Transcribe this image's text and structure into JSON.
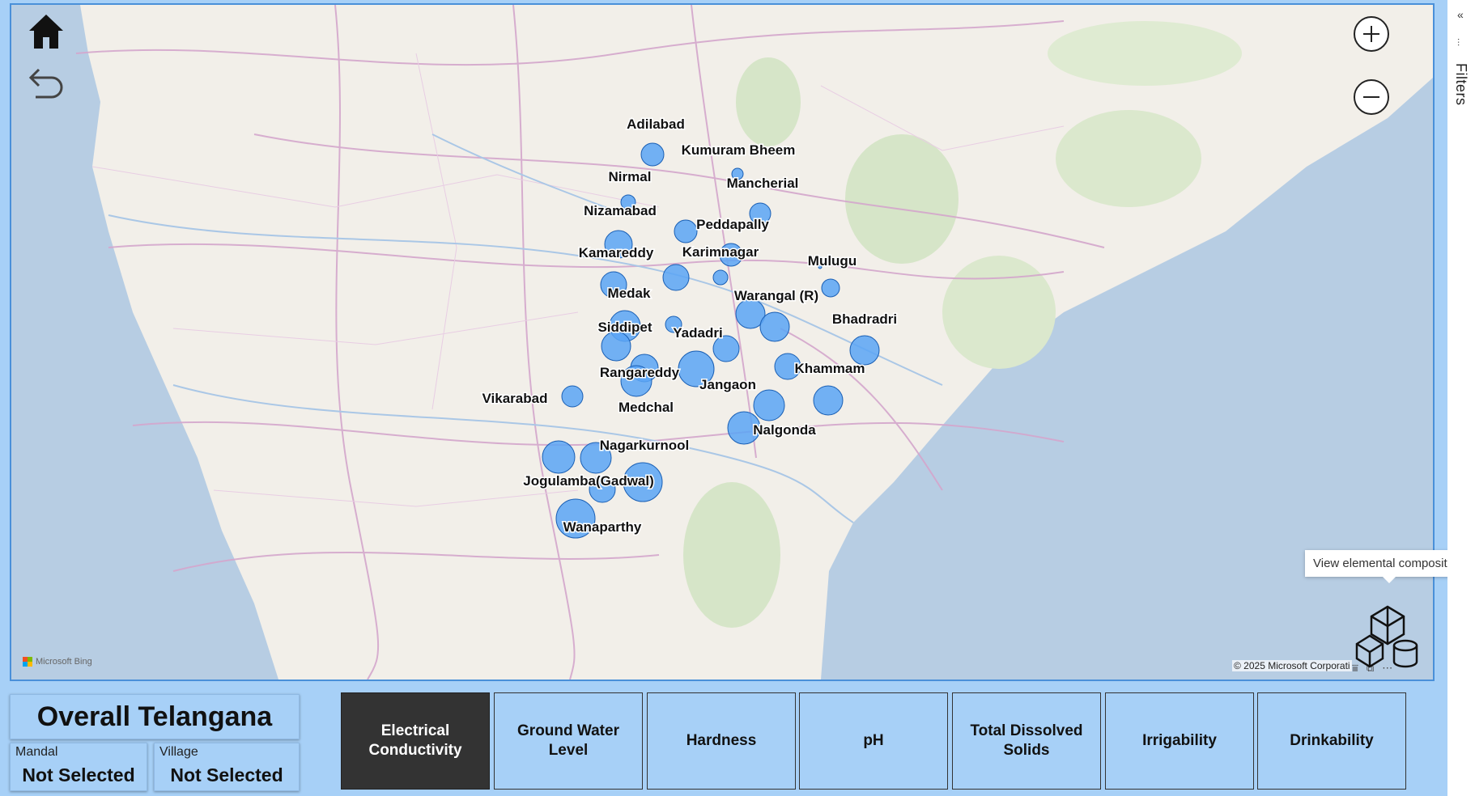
{
  "map": {
    "attribution_logo": "Microsoft Bing",
    "copyright": "© 2025 Microsoft Corporati",
    "districts": [
      "Adilabad",
      "Kumuram Bheem",
      "Nirmal",
      "Mancherial",
      "Nizamabad",
      "Peddapally",
      "Kamareddy",
      "Karimnagar",
      "Mulugu",
      "Medak",
      "Warangal (R)",
      "Bhadradri",
      "Siddipet",
      "Yadadri",
      "Rangareddy",
      "Jangaon",
      "Khammam",
      "Vikarabad",
      "Medchal",
      "Nalgonda",
      "Nagarkurnool",
      "Jogulamba(Gadwal)",
      "Wanaparthy"
    ],
    "bubble_color": "#5aa5f5"
  },
  "filters": {
    "label": "Filters"
  },
  "tooltip": {
    "text": "View elemental composition"
  },
  "region": {
    "title": "Overall Telangana"
  },
  "selectors": {
    "mandal": {
      "label": "Mandal",
      "value": "Not Selected"
    },
    "village": {
      "label": "Village",
      "value": "Not Selected"
    }
  },
  "metrics": [
    {
      "label": "Electrical Conductivity",
      "active": true
    },
    {
      "label": "Ground Water Level",
      "active": false
    },
    {
      "label": "Hardness",
      "active": false
    },
    {
      "label": "pH",
      "active": false
    },
    {
      "label": "Total Dissolved Solids",
      "active": false
    },
    {
      "label": "Irrigability",
      "active": false
    },
    {
      "label": "Drinkability",
      "active": false
    }
  ],
  "colors": {
    "background": "#a7d0f7",
    "active_button": "#333333",
    "sea": "#b7cde3"
  }
}
